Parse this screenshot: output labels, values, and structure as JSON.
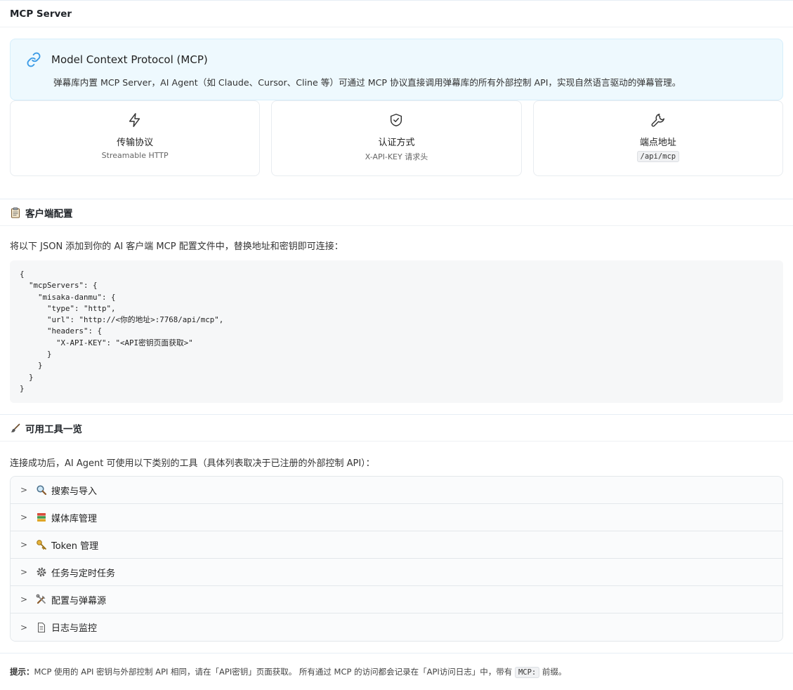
{
  "header": {
    "title": "MCP Server"
  },
  "intro": {
    "title": "Model Context Protocol (MCP)",
    "description": "弹幕库内置 MCP Server，AI Agent（如 Claude、Cursor、Cline 等）可通过 MCP 协议直接调用弹幕库的所有外部控制 API，实现自然语言驱动的弹幕管理。",
    "icon": "link-icon"
  },
  "stats": [
    {
      "icon": "lightning-icon",
      "title": "传输协议",
      "value": "Streamable HTTP"
    },
    {
      "icon": "shield-check-icon",
      "title": "认证方式",
      "value": "X-API-KEY 请求头"
    },
    {
      "icon": "wrench-icon",
      "title": "端点地址",
      "value": "/api/mcp"
    }
  ],
  "client_config": {
    "title": "客户端配置",
    "icon": "clipboard-icon",
    "description": "将以下 JSON 添加到你的 AI 客户端 MCP 配置文件中，替换地址和密钥即可连接：",
    "code": "{\n  \"mcpServers\": {\n    \"misaka-danmu\": {\n      \"type\": \"http\",\n      \"url\": \"http://<你的地址>:7768/api/mcp\",\n      \"headers\": {\n        \"X-API-KEY\": \"<API密钥页面获取>\"\n      }\n    }\n  }\n}"
  },
  "tools": {
    "title": "可用工具一览",
    "icon": "brush-icon",
    "description": "连接成功后，AI Agent 可使用以下类别的工具（具体列表取决于已注册的外部控制 API）：",
    "items": [
      {
        "label": "搜索与导入",
        "icon": "magnifier-icon"
      },
      {
        "label": "媒体库管理",
        "icon": "books-icon"
      },
      {
        "label": "Token 管理",
        "icon": "key-icon"
      },
      {
        "label": "任务与定时任务",
        "icon": "gear-icon"
      },
      {
        "label": "配置与弹幕源",
        "icon": "tools-icon"
      },
      {
        "label": "日志与监控",
        "icon": "document-icon"
      }
    ]
  },
  "footer": {
    "label": "提示：",
    "text1": "MCP 使用的 API 密钥与外部控制 API 相同，请在「API密钥」页面获取。 所有通过 MCP 的访问都会记录在「API访问日志」中，带有",
    "chip": "MCP:",
    "text2": "前缀。"
  }
}
